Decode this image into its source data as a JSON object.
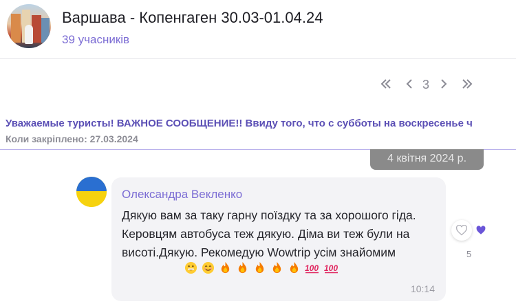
{
  "header": {
    "title": "Варшава - Копенгаген 30.03-01.04.24",
    "members": "39 учасників"
  },
  "pagination": {
    "current_page": "3",
    "first_icon": "double-chevron-left-icon",
    "prev_icon": "chevron-left-icon",
    "next_icon": "chevron-right-icon",
    "last_icon": "double-chevron-right-icon"
  },
  "pinned": {
    "text": "Уважаемые туристы! ВАЖНОЕ СООБЩЕНИЕ!! Ввиду того, что с субботы на воскресенье ч",
    "pinned_label": "Коли закріплено: 27.03.2024"
  },
  "date_separator": "4 квітня 2024 р.",
  "message": {
    "sender": "Олександра Векленко",
    "text": "Дякую вам за таку гарну поїздку та за хорошого гіда. Керовцям автобуса теж дякую. Діма ви теж були на висоті.Дякую. Рекомедую Wowtrip усім знайомим",
    "time": "10:14",
    "emojis": [
      "grinning-face",
      "smiling-face",
      "fire",
      "fire",
      "fire",
      "fire",
      "fire",
      "hundred-points",
      "hundred-points"
    ],
    "reactions": {
      "count": "5",
      "heart_icon": "heart-outline-icon",
      "liked_icon": "heart-filled-icon"
    }
  },
  "colors": {
    "accent": "#7b6cd4",
    "pinned_text": "#5b4fb5",
    "bubble_bg": "#f3f3f6",
    "date_chip": "#8a8a8a"
  }
}
